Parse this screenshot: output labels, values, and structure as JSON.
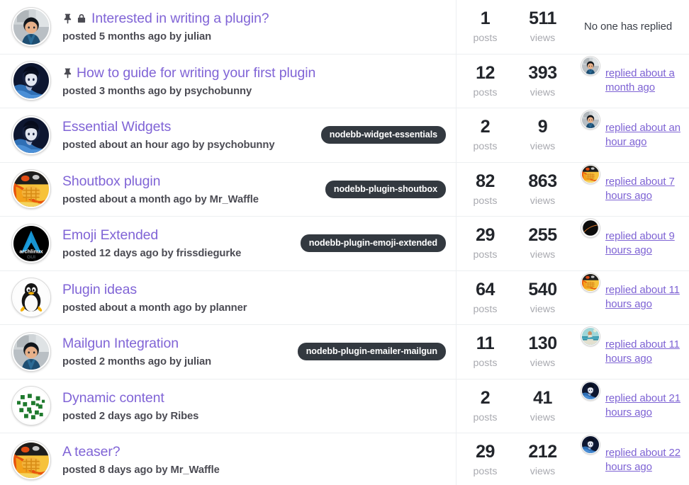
{
  "labels": {
    "posts": "posts",
    "views": "views",
    "no_reply": "No one has replied"
  },
  "colors": {
    "title_link": "#8064d6",
    "reply_link": "#7e63d4",
    "tag_bg": "#333940",
    "stat_value": "#22252b",
    "stat_label": "#a9aab0",
    "divider": "#eceff1"
  },
  "topics": [
    {
      "title": "Interested in writing a plugin?",
      "meta": "posted 5 months ago by julian",
      "pinned": true,
      "locked": true,
      "tag": "",
      "posts": "1",
      "views": "511",
      "reply_text": "No one has replied",
      "has_replier": false,
      "avatar": "julian",
      "reply_avatar": ""
    },
    {
      "title": "How to guide for writing your first plugin",
      "meta": "posted 3 months ago by psychobunny",
      "pinned": true,
      "locked": false,
      "tag": "",
      "posts": "12",
      "views": "393",
      "reply_text": "replied about a month ago",
      "has_replier": true,
      "avatar": "psychobunny",
      "reply_avatar": "julian"
    },
    {
      "title": "Essential Widgets",
      "meta": "posted about an hour ago by psychobunny",
      "pinned": false,
      "locked": false,
      "tag": "nodebb-widget-essentials",
      "posts": "2",
      "views": "9",
      "reply_text": "replied about an hour ago",
      "has_replier": true,
      "avatar": "psychobunny",
      "reply_avatar": "julian"
    },
    {
      "title": "Shoutbox plugin",
      "meta": "posted about a month ago by Mr_Waffle",
      "pinned": false,
      "locked": false,
      "tag": "nodebb-plugin-shoutbox",
      "posts": "82",
      "views": "863",
      "reply_text": "replied about 7 hours ago",
      "has_replier": true,
      "avatar": "waffle",
      "reply_avatar": "waffle"
    },
    {
      "title": "Emoji Extended",
      "meta": "posted 12 days ago by frissdiegurke",
      "pinned": false,
      "locked": false,
      "tag": "nodebb-plugin-emoji-extended",
      "posts": "29",
      "views": "255",
      "reply_text": "replied about 9 hours ago",
      "has_replier": true,
      "avatar": "archlinux",
      "reply_avatar": "dark"
    },
    {
      "title": "Plugin ideas",
      "meta": "posted about a month ago by planner",
      "pinned": false,
      "locked": false,
      "tag": "",
      "posts": "64",
      "views": "540",
      "reply_text": "replied about 11 hours ago",
      "has_replier": true,
      "avatar": "tux",
      "reply_avatar": "waffle"
    },
    {
      "title": "Mailgun Integration",
      "meta": "posted 2 months ago by julian",
      "pinned": false,
      "locked": false,
      "tag": "nodebb-plugin-emailer-mailgun",
      "posts": "11",
      "views": "130",
      "reply_text": "replied about 11 hours ago",
      "has_replier": true,
      "avatar": "julian",
      "reply_avatar": "beach"
    },
    {
      "title": "Dynamic content",
      "meta": "posted 2 days ago by Ribes",
      "pinned": false,
      "locked": false,
      "tag": "",
      "posts": "2",
      "views": "41",
      "reply_text": "replied about 21 hours ago",
      "has_replier": true,
      "avatar": "ribes",
      "reply_avatar": "psychobunny"
    },
    {
      "title": "A teaser?",
      "meta": "posted 8 days ago by Mr_Waffle",
      "pinned": false,
      "locked": false,
      "tag": "",
      "posts": "29",
      "views": "212",
      "reply_text": "replied about 22 hours ago",
      "has_replier": true,
      "avatar": "waffle",
      "reply_avatar": "psychobunny"
    }
  ]
}
